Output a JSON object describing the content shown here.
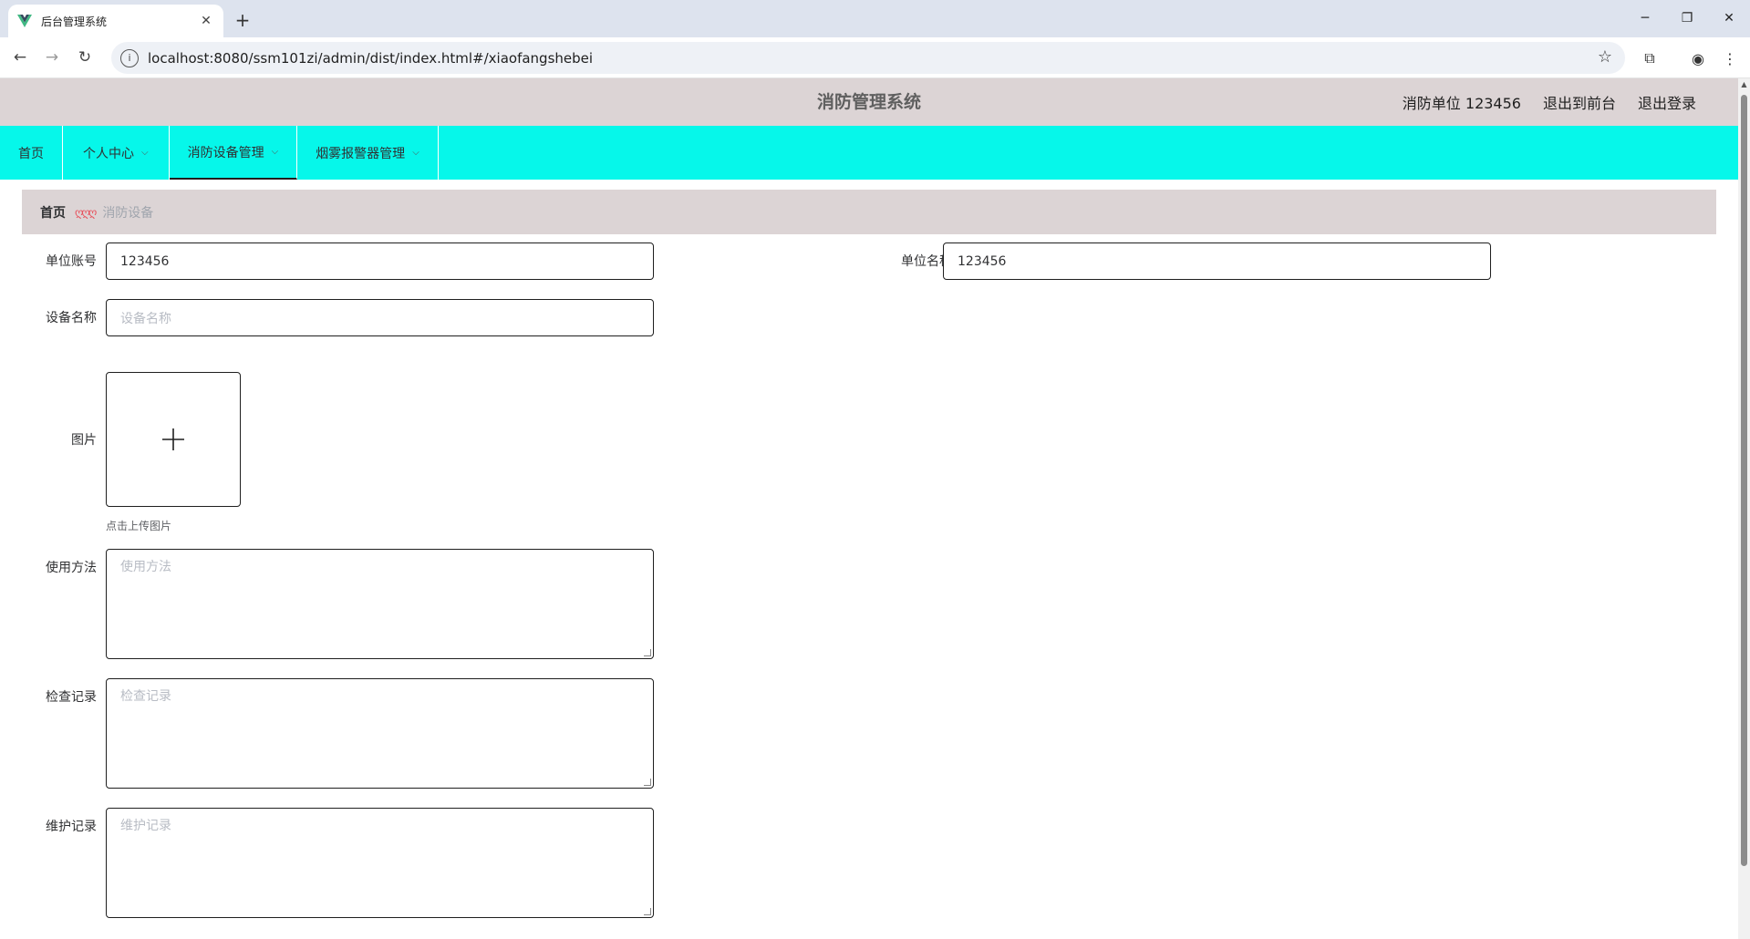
{
  "browser": {
    "tab_title": "后台管理系统",
    "url": "localhost:8080/ssm101zi/admin/dist/index.html#/xiaofangshebei"
  },
  "header": {
    "title": "消防管理系统",
    "user": "消防单位 123456",
    "back_front": "退出到前台",
    "logout": "退出登录"
  },
  "menu": {
    "home": "首页",
    "personal": "个人中心",
    "fire_equipment": "消防设备管理",
    "smoke_alarm": "烟雾报警器管理"
  },
  "breadcrumb": {
    "home": "首页",
    "separator": "ღღღ",
    "current": "消防设备"
  },
  "form": {
    "unit_account_label": "单位账号",
    "unit_account_value": "123456",
    "unit_name_label": "单位名称",
    "unit_name_value": "123456",
    "device_name_label": "设备名称",
    "device_name_placeholder": "设备名称",
    "image_label": "图片",
    "upload_tip": "点击上传图片",
    "usage_label": "使用方法",
    "usage_placeholder": "使用方法",
    "inspection_label": "检查记录",
    "inspection_placeholder": "检查记录",
    "maintenance_label": "维护记录",
    "maintenance_placeholder": "维护记录"
  },
  "colors": {
    "header_bg": "#dcd4d5",
    "menu_bg": "#06f7ea",
    "breadcrumb_sep": "#e8505b"
  }
}
